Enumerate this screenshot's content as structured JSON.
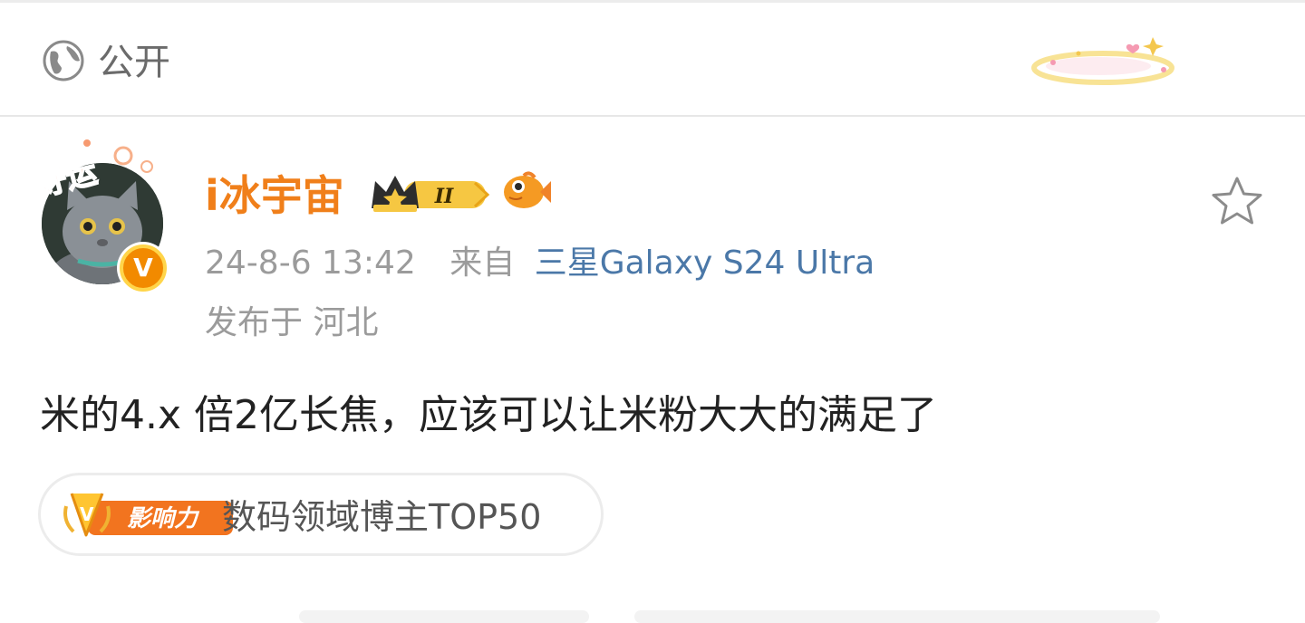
{
  "privacy": {
    "label": "公开",
    "icon": "globe-icon"
  },
  "post": {
    "author": {
      "name": "i冰宇宙",
      "avatar_badge": "V",
      "avatar_sticker": "好运"
    },
    "time": "24-8-6 13:42",
    "source_prefix": "来自",
    "device": "三星Galaxy S24 Ultra",
    "location": "发布于 河北",
    "text": "米的4.x 倍2亿长焦，应该可以让米粉大大的满足了",
    "influence": {
      "badge_label": "影响力",
      "badge_letter": "V",
      "text": "数码领域博主TOP50"
    },
    "vip_level": "II"
  },
  "colors": {
    "username": "#f07f1a",
    "device_link": "#4b78a8",
    "meta": "#9b9b9b",
    "body": "#222222"
  }
}
